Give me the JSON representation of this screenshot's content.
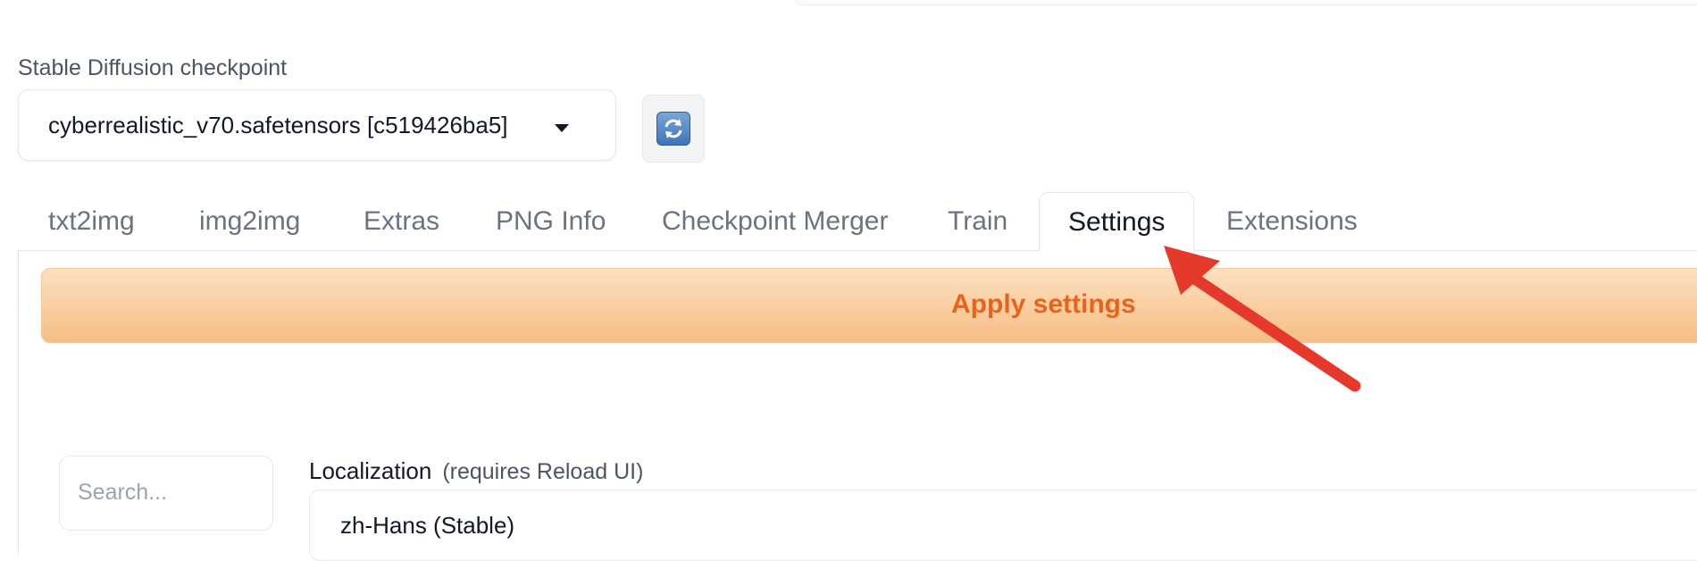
{
  "checkpoint": {
    "label": "Stable Diffusion checkpoint",
    "value": "cyberrealistic_v70.safetensors [c519426ba5]"
  },
  "tabs": [
    {
      "label": "txt2img"
    },
    {
      "label": "img2img"
    },
    {
      "label": "Extras"
    },
    {
      "label": "PNG Info"
    },
    {
      "label": "Checkpoint Merger"
    },
    {
      "label": "Train"
    },
    {
      "label": "Settings",
      "active": true
    },
    {
      "label": "Extensions"
    }
  ],
  "settings": {
    "apply_label": "Apply settings",
    "search_placeholder": "Search...",
    "localization_label": "Localization",
    "localization_hint": "(requires Reload UI)",
    "localization_value": "zh-Hans (Stable)"
  },
  "colors": {
    "accent_orange": "#e8641c",
    "annotation_arrow": "#e5392b"
  }
}
